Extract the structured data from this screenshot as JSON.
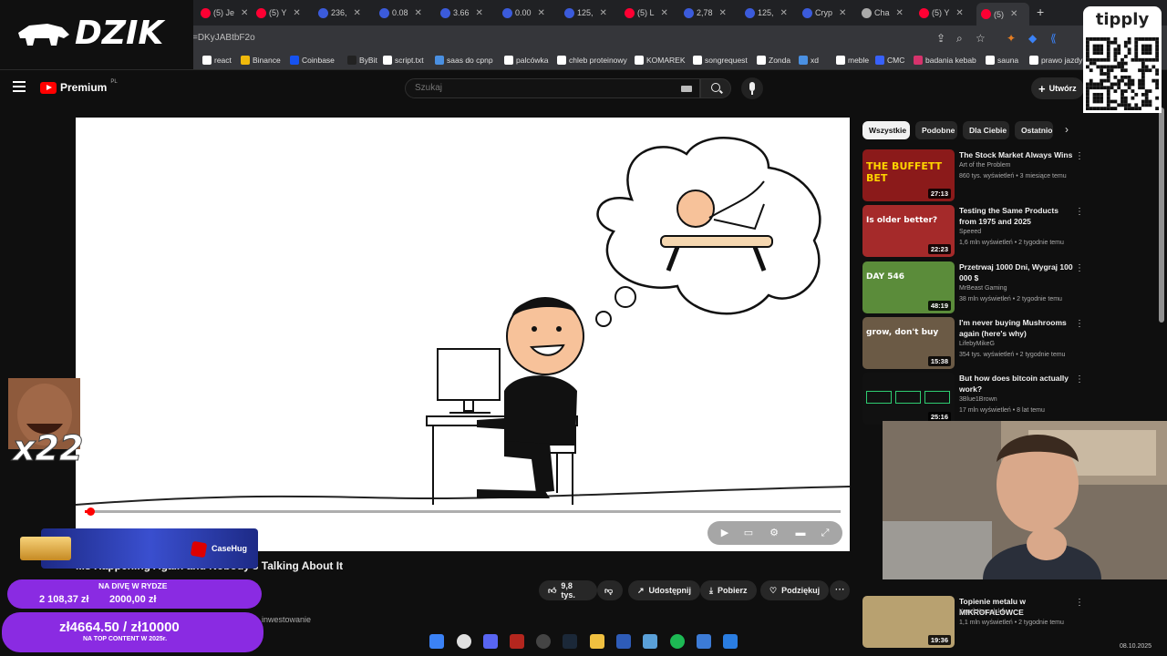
{
  "browser": {
    "tabs": [
      {
        "label": "(5) Je",
        "color": "#ff0033"
      },
      {
        "label": "(5) Y",
        "color": "#ff0033"
      },
      {
        "label": "236,",
        "color": "#3b5bdb"
      },
      {
        "label": "0.08",
        "color": "#3b5bdb"
      },
      {
        "label": "3.66",
        "color": "#3b5bdb"
      },
      {
        "label": "0.00",
        "color": "#3b5bdb"
      },
      {
        "label": "125,",
        "color": "#3b5bdb"
      },
      {
        "label": "(5) L",
        "color": "#ff0033"
      },
      {
        "label": "2,78",
        "color": "#3b5bdb"
      },
      {
        "label": "125,",
        "color": "#3b5bdb"
      },
      {
        "label": "Cryp",
        "color": "#3b5bdb"
      },
      {
        "label": "Cha",
        "color": "#aaaaaa"
      },
      {
        "label": "(5) Y",
        "color": "#ff0033"
      }
    ],
    "url": "v=DKyJABtbF2o",
    "bookmarks": [
      {
        "label": "react",
        "color": "#ffffff"
      },
      {
        "label": "Binance",
        "color": "#f0b90b"
      },
      {
        "label": "Coinbase",
        "color": "#1652f0"
      },
      {
        "label": "ByBit",
        "color": "#222222"
      },
      {
        "label": "script.txt",
        "color": "#ffffff"
      },
      {
        "label": "saas do cpnp",
        "color": "#4a90e2"
      },
      {
        "label": "palcówka",
        "color": "#ffffff"
      },
      {
        "label": "chleb proteinowy",
        "color": "#ffffff"
      },
      {
        "label": "KOMAREK",
        "color": "#ffffff"
      },
      {
        "label": "songrequest",
        "color": "#ffffff"
      },
      {
        "label": "Zonda",
        "color": "#ffffff"
      },
      {
        "label": "xd",
        "color": "#4a90e2"
      },
      {
        "label": "meble",
        "color": "#ffffff"
      },
      {
        "label": "CMC",
        "color": "#3861fb"
      },
      {
        "label": "badania kebab",
        "color": "#d6336c"
      },
      {
        "label": "sauna",
        "color": "#ffffff"
      },
      {
        "label": "prawo jazdy",
        "color": "#ffffff"
      }
    ]
  },
  "overlay": {
    "brand": "DZIK",
    "tipply": "tipply",
    "emote_multiplier": "x22",
    "casehug": "CaseHug",
    "goal1": {
      "title": "NA DIVĘ W RYDZE",
      "current": "2 108,37 zł",
      "target": "2000,00 zł"
    },
    "goal2": {
      "amount": "zł4664.50 / zł10000",
      "subtitle": "NA TOP CONTENT W 2025r."
    }
  },
  "youtube": {
    "brand": "Premium",
    "country": "PL",
    "search_placeholder": "Szukaj",
    "create_label": "Utwórz",
    "video": {
      "title": "...s Happening Again and Nobody's Talking About It",
      "progress": 0.012,
      "likes": "9,8 tys.",
      "share": "Udostępnij",
      "download": "Pobierz",
      "thanks": "Podziękuj",
      "description_snippet": "inwestowanie"
    },
    "chips": [
      {
        "label": "Wszystkie"
      },
      {
        "label": "Podobne"
      },
      {
        "label": "Dla Ciebie"
      },
      {
        "label": "Ostatnio"
      }
    ],
    "recommendations": [
      {
        "title": "The Stock Market Always Wins",
        "channel": "Art of the Problem",
        "meta": "860 tys. wyświetleń • 3 miesiące temu",
        "duration": "27:13",
        "thumb_text": "THE BUFFETT BET",
        "thumb_bg": "#8b1a1a"
      },
      {
        "title": "Testing the Same Products from 1975 and 2025",
        "channel": "Speeed",
        "meta": "1,6 mln wyświetleń • 2 tygodnie temu",
        "duration": "22:23",
        "thumb_text": "Is older better?",
        "thumb_bg": "#a52a2a"
      },
      {
        "title": "Przetrwaj 1000 Dni, Wygraj 100 000 $",
        "channel": "MrBeast Gaming",
        "meta": "38 mln wyświetleń • 2 tygodnie temu",
        "duration": "48:19",
        "thumb_text": "DAY 546",
        "thumb_bg": "#5b8c3a"
      },
      {
        "title": "I'm never buying Mushrooms again (here's why)",
        "channel": "LifebyMikeG",
        "meta": "354 tys. wyświetleń • 2 tygodnie temu",
        "duration": "15:38",
        "thumb_text": "grow, don't buy",
        "thumb_bg": "#6b5a45"
      },
      {
        "title": "But how does bitcoin actually work?",
        "channel": "3Blue1Brown",
        "meta": "17 mln wyświetleń • 8 lat temu",
        "duration": "25:16",
        "thumb_text": "",
        "thumb_bg": "#111111"
      },
      {
        "title": "Topienie metalu w MIKROFALÓWCE",
        "channel": "Kamil Kamelsky",
        "meta": "1,1 mln wyświetleń • 2 tygodnie temu",
        "duration": "19:36",
        "thumb_text": "",
        "thumb_bg": "#b8a170"
      }
    ]
  },
  "taskbar": {
    "date": "08.10.2025"
  }
}
